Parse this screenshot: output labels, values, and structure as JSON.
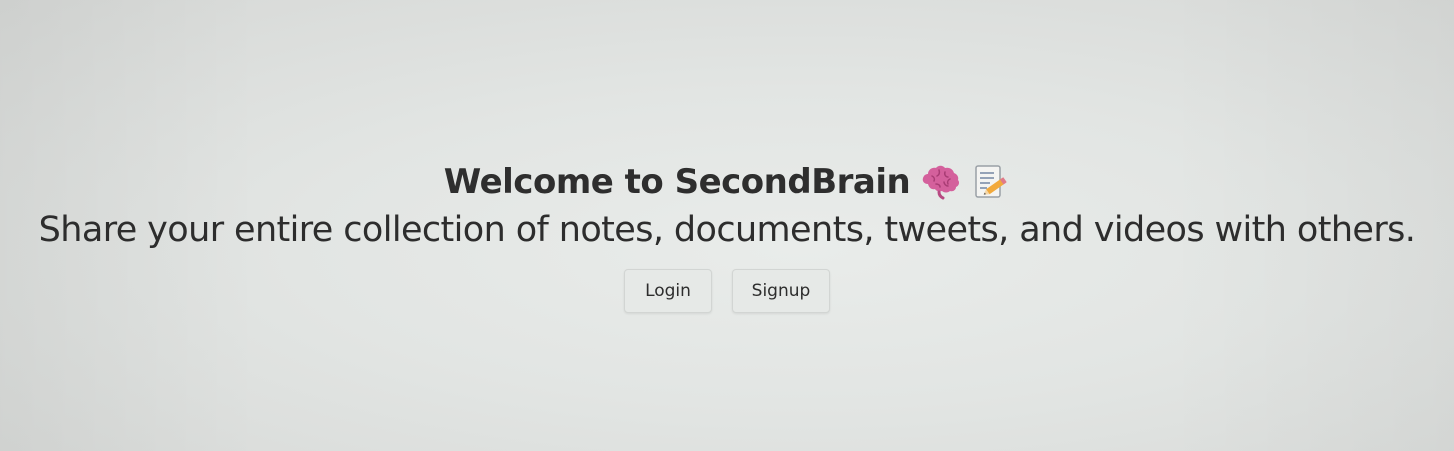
{
  "hero": {
    "title": "Welcome to SecondBrain",
    "title_icons": [
      "brain-icon",
      "memo-icon"
    ],
    "subtitle": "Share your entire collection of notes, documents, tweets, and videos with others."
  },
  "actions": {
    "login_label": "Login",
    "signup_label": "Signup"
  },
  "colors": {
    "background": "#e3e6e4",
    "text": "#2d2d2d",
    "brain_icon": "#d65a9a"
  }
}
